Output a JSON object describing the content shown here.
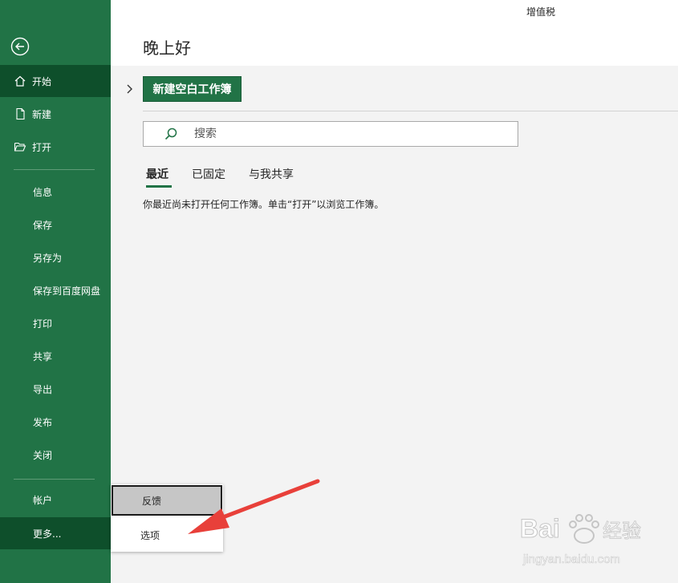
{
  "window": {
    "doc_title": "增值税"
  },
  "greeting": "晚上好",
  "sidebar": {
    "primary": [
      {
        "label": "开始",
        "icon": "home-icon"
      },
      {
        "label": "新建",
        "icon": "new-file-icon"
      },
      {
        "label": "打开",
        "icon": "folder-open-icon"
      }
    ],
    "items": [
      "信息",
      "保存",
      "另存为",
      "保存到百度网盘",
      "打印",
      "共享",
      "导出",
      "发布",
      "关闭"
    ],
    "account": "帐户",
    "more": "更多..."
  },
  "main": {
    "new_workbook": "新建空白工作簿",
    "search_placeholder": "搜索",
    "tabs": [
      "最近",
      "已固定",
      "与我共享"
    ],
    "empty_message": "你最近尚未打开任何工作簿。单击“打开”以浏览工作簿。"
  },
  "popup": {
    "items": [
      "反馈",
      "选项"
    ]
  },
  "watermark": {
    "brand": "Bai",
    "brand2": "经验",
    "url": "jingyan.baidu.com"
  },
  "colors": {
    "accent": "#217346",
    "accent_dark": "#0e4f2b",
    "arrow": "#e8403a"
  }
}
